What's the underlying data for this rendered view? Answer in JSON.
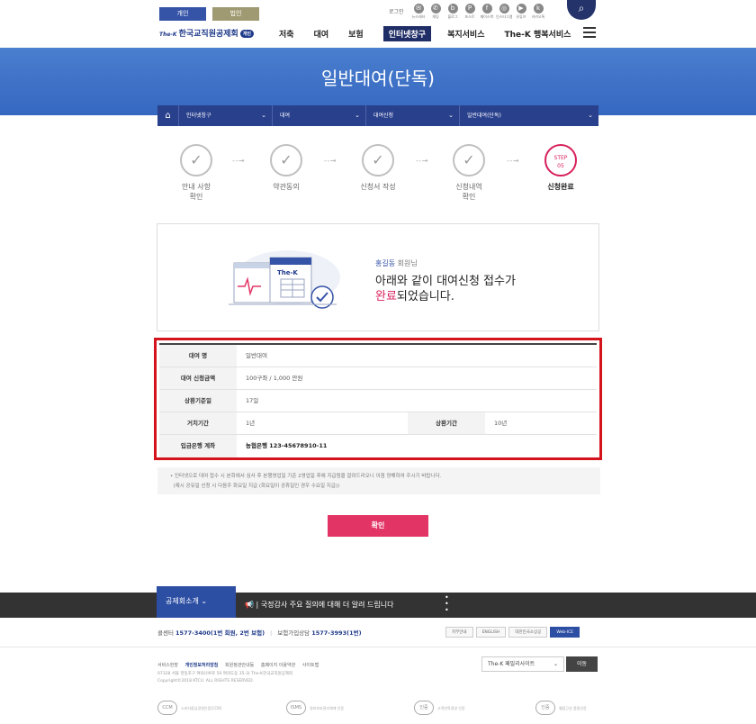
{
  "header": {
    "tab_personal": "개인",
    "tab_corp": "법인",
    "logo_prefix": "The-K",
    "logo_text": "한국교직원공제회",
    "logo_badge": "개인",
    "login": "로그인",
    "util_items": [
      "뉴스레터",
      "채팅",
      "블로그",
      "포스트",
      "페이스북",
      "인스타그램",
      "유튜브",
      "카카오톡"
    ],
    "nav": [
      "저축",
      "대여",
      "보험",
      "인터넷창구",
      "복지서비스",
      "The-K 행복서비스"
    ],
    "nav_active_index": 3
  },
  "banner": {
    "title": "일반대여(단독)"
  },
  "breadcrumb": [
    "인터넷창구",
    "대여",
    "대여신청",
    "일반대여(단독)"
  ],
  "steps": [
    {
      "label1": "안내 사항",
      "label2": "확인"
    },
    {
      "label1": "약관동의",
      "label2": ""
    },
    {
      "label1": "신청서 작성",
      "label2": ""
    },
    {
      "label1": "신청내역",
      "label2": "확인"
    },
    {
      "step_tag": "STEP",
      "step_num": "05",
      "label1": "신청완료",
      "label2": ""
    }
  ],
  "complete": {
    "member_name": "홍길동",
    "member_suffix": " 회원님",
    "msg1": "아래와 같이 대여신청 접수가",
    "msg2_hl": "완료",
    "msg2_rest": "되었습니다."
  },
  "details": {
    "loan_name_label": "대여 명",
    "loan_name": "일반대여",
    "amount_label": "대여 신청금액",
    "amount": "100구좌 / 1,000 만원",
    "repay_day_label": "상환기준일",
    "repay_day": "17일",
    "grace_label": "거치기간",
    "grace": "1년",
    "repay_period_label": "상환기간",
    "repay_period": "10년",
    "bank_label": "입금은행 계좌",
    "bank": "농협은행 123-45678910-11"
  },
  "notice": [
    "인터넷으로 대여 접수 시 본회에서 심사 후 본행영업일 기준 2영업일 후에 지급됨을 알려드리오니 이점 양해하여 주시기 바랍니다.",
    "(제시 공유일 신청 시 다음주 화요일 지급 (화요일이 공휴일인 경우 수요일 지급))"
  ],
  "confirm_label": "확인",
  "footer": {
    "intro_tab": "공제회소개",
    "ticker": "국정감사 주요 질의에 대해 더 알려 드립니다",
    "call_center_label": "콜센터",
    "call_center": "1577-3400(1번 회원, 2번 보험)",
    "insurance_label": "보험가입상담",
    "insurance": "1577-3993(1번)",
    "badges": [
      "지부안내",
      "ENGLISH",
      "대한민국소상공",
      "Web-ICE"
    ],
    "links": [
      "서비스헌장",
      "개인정보처리방침",
      "회원정관안내등",
      "홈페이지 이용약관",
      "사이트맵"
    ],
    "address": "07328 서울 영등포구 여의나루로 50 여의도동 35-3) The-K한국교직원공제회",
    "copyright": "Copyright©2018 KTCU. ALL RIGHTS RESERVED.",
    "family_site": "The-K 패밀리사이트",
    "go": "이동",
    "certs": [
      "CCM",
      "ISMS",
      "인증",
      "인증"
    ],
    "cert_texts": [
      "소비자중심경영인증(CCM)",
      "정보보호관리체계 인증",
      "고객만족경영 인증",
      "웹접근성 품질인증"
    ]
  },
  "colors": {
    "primary": "#29408d",
    "accent": "#d71f5a",
    "banner": "#3d70c6",
    "highlight_border": "#d4141c"
  }
}
